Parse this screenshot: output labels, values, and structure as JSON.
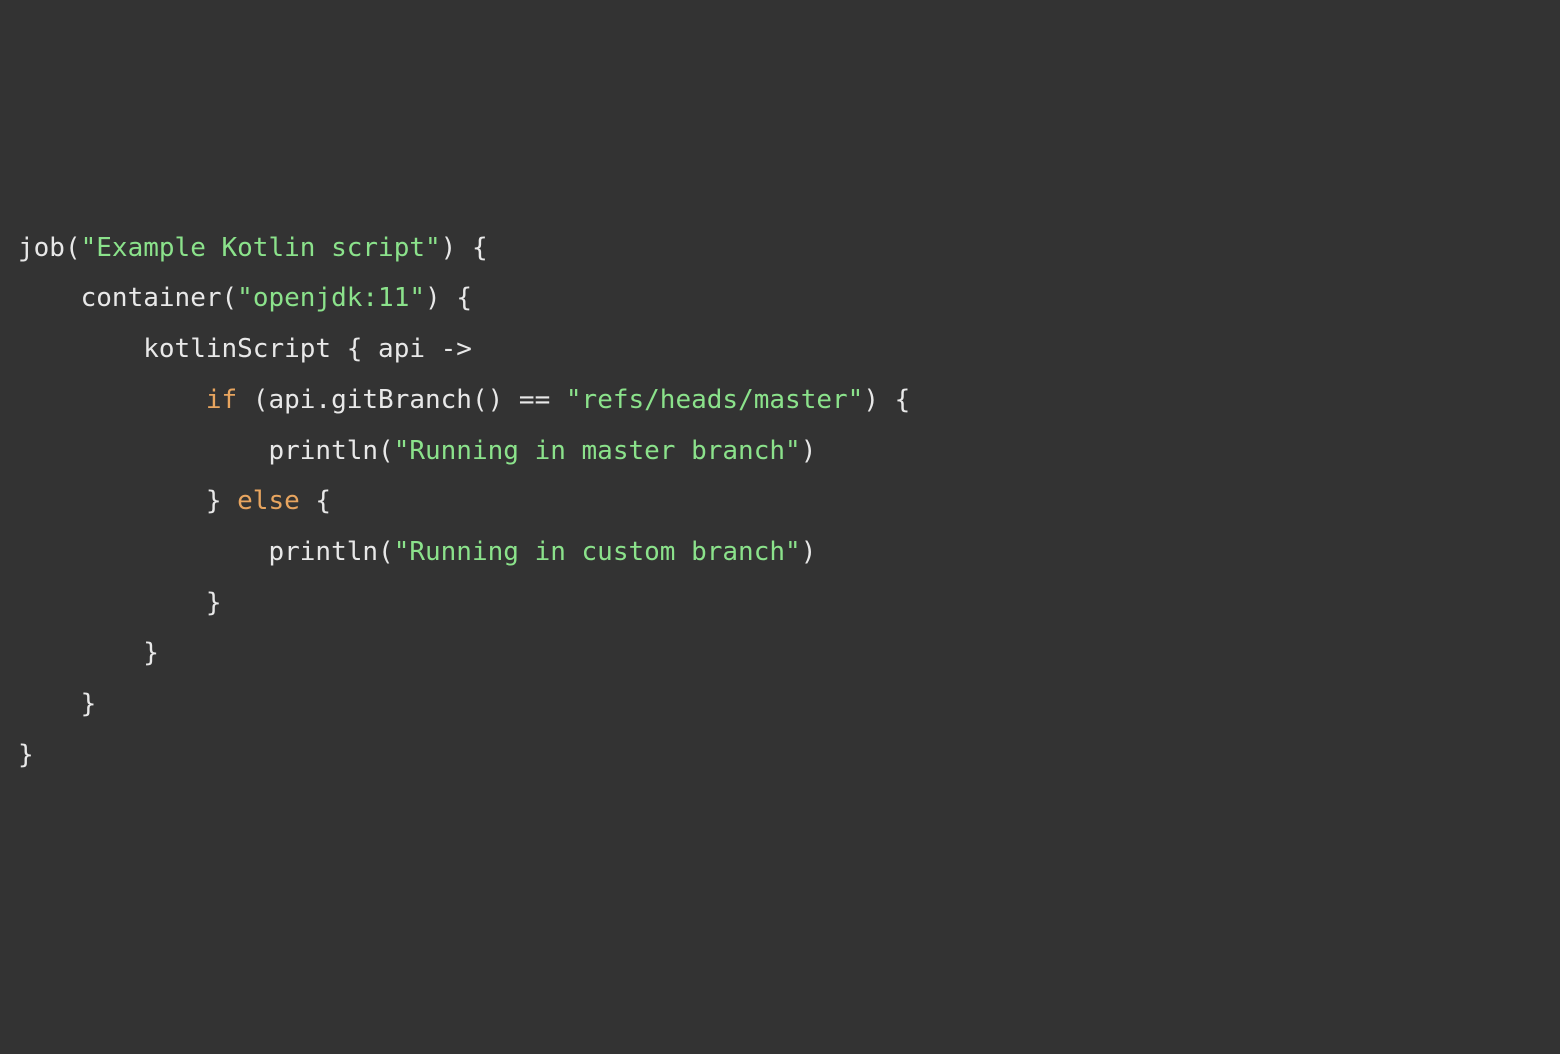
{
  "code": {
    "line1": {
      "fn": "job(",
      "str": "\"Example Kotlin script\"",
      "rest": ") {"
    },
    "line2": {
      "indent": "    ",
      "fn": "container(",
      "str": "\"openjdk:11\"",
      "rest": ") {"
    },
    "line3": {
      "indent": "        ",
      "text": "kotlinScript { api ->"
    },
    "line4": {
      "indent": "            ",
      "kw": "if",
      "mid": " (api.gitBranch() == ",
      "str": "\"refs/heads/master\"",
      "rest": ") {"
    },
    "line5": {
      "indent": "                ",
      "fn": "println(",
      "str": "\"Running in master branch\"",
      "rest": ")"
    },
    "line6": {
      "indent": "            ",
      "brace": "} ",
      "kw": "else",
      "rest": " {"
    },
    "line7": {
      "indent": "                ",
      "fn": "println(",
      "str": "\"Running in custom branch\"",
      "rest": ")"
    },
    "line8": {
      "indent": "            ",
      "text": "}"
    },
    "line9": {
      "indent": "        ",
      "text": "}"
    },
    "line10": {
      "indent": "    ",
      "text": "}"
    },
    "line11": {
      "text": "}"
    }
  }
}
